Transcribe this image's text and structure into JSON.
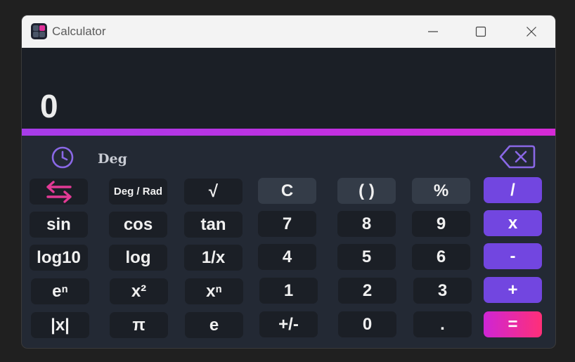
{
  "window": {
    "title": "Calculator"
  },
  "display": {
    "value": "0",
    "mode": "Deg"
  },
  "buttons": {
    "swap": "",
    "deg_rad": "Deg / Rad",
    "sqrt": "√",
    "clear": "C",
    "parens": "( )",
    "percent": "%",
    "divide": "/",
    "sin": "sin",
    "cos": "cos",
    "tan": "tan",
    "seven": "7",
    "eight": "8",
    "nine": "9",
    "multiply": "x",
    "log10": "log10",
    "log": "log",
    "reciprocal": "1/x",
    "four": "4",
    "five": "5",
    "six": "6",
    "subtract": "-",
    "exp": "eⁿ",
    "square": "x²",
    "power": "xⁿ",
    "one": "1",
    "two": "2",
    "three": "3",
    "add": "+",
    "abs": "|x|",
    "pi": "π",
    "e": "e",
    "negate": "+/-",
    "zero": "0",
    "decimal": ".",
    "equals": "="
  },
  "icons": {
    "app": "calculator-app-icon",
    "history": "history-clock-icon",
    "backspace": "backspace-icon",
    "swap": "swap-arrows-icon",
    "minimize": "minimize-icon",
    "maximize": "maximize-icon",
    "close": "close-icon"
  },
  "colors": {
    "accent_purple": "#7246e0",
    "accent_pink": "#e0309a",
    "display_bg": "#1b1f26",
    "panel_bg": "#232934"
  }
}
